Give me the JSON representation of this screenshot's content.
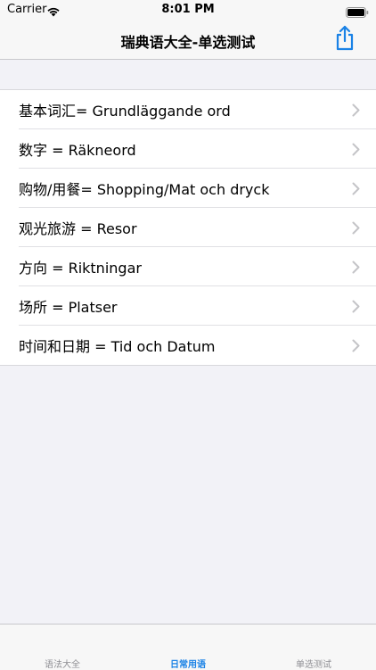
{
  "status_bar": {
    "carrier": "Carrier",
    "time": "8:01 PM"
  },
  "nav": {
    "title": "瑞典语大全-单选测试",
    "share_icon": "share-icon"
  },
  "list": {
    "items": [
      {
        "label": "基本词汇= Grundläggande ord"
      },
      {
        "label": "数字 = Räkneord"
      },
      {
        "label": "购物/用餐= Shopping/Mat och dryck"
      },
      {
        "label": "观光旅游 = Resor"
      },
      {
        "label": "方向 = Riktningar"
      },
      {
        "label": "场所 = Platser"
      },
      {
        "label": "时间和日期 = Tid och Datum"
      }
    ]
  },
  "tab_bar": {
    "tabs": [
      {
        "label": "语法大全"
      },
      {
        "label": "日常用语"
      },
      {
        "label": "单选测试"
      }
    ],
    "active_index": 1
  },
  "colors": {
    "accent": "#1a82e6",
    "background": "#f2f2f7",
    "bar_background": "#f7f7f7",
    "inactive_tab": "#8e8e93"
  }
}
